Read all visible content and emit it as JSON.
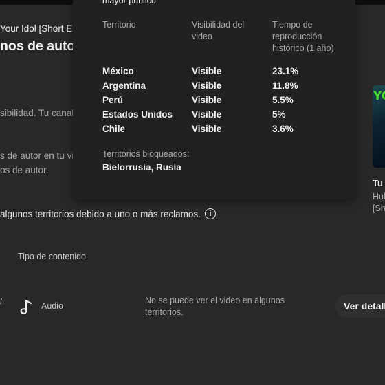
{
  "background": {
    "video_title": "Your Idol [Short Ed",
    "heading": "nos de autor",
    "line1": "sibilidad. Tu canal",
    "line2": "s de autor en tu vid",
    "line3": "os de autor.",
    "notice": "algunos territorios debido a uno o más reclamos.",
    "info_icon": "info-icon"
  },
  "table": {
    "content_type_header": "Tipo de contenido",
    "row": {
      "left_fragment": "/,",
      "icon": "music-note-icon",
      "type": "Audio",
      "restriction": "No se puede ver el video en algunos territorios.",
      "details_button": "Ver detall"
    }
  },
  "side_video": {
    "thumbnail_text": "YO",
    "title": "Tu",
    "meta1": "Hul",
    "meta2": "[Sh"
  },
  "popup": {
    "title_fragment": "mayor público",
    "columns": [
      "Territorio",
      "Visibilidad del video",
      "Tiempo de reproducción histórico (1 año)"
    ],
    "rows": [
      {
        "territory": "México",
        "visibility": "Visible",
        "watch_time": "23.1%"
      },
      {
        "territory": "Argentina",
        "visibility": "Visible",
        "watch_time": "11.8%"
      },
      {
        "territory": "Perú",
        "visibility": "Visible",
        "watch_time": "5.5%"
      },
      {
        "territory": "Estados Unidos",
        "visibility": "Visible",
        "watch_time": "5%"
      },
      {
        "territory": "Chile",
        "visibility": "Visible",
        "watch_time": "3.6%"
      }
    ],
    "blocked_label": "Territorios bloqueados:",
    "blocked_list": "Bielorrusia, Rusia"
  },
  "colors": {
    "background": "#282828",
    "popup": "#212121",
    "thumbnail_accent": "#49e02b"
  }
}
